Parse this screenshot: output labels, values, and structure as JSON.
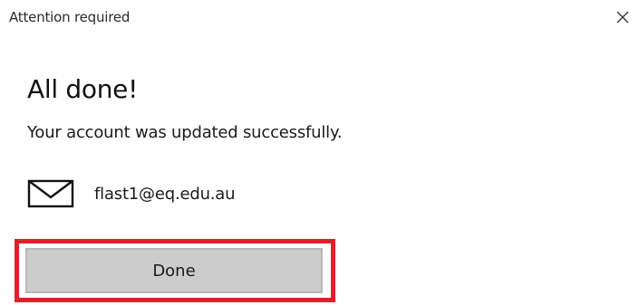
{
  "window": {
    "title": "Attention required",
    "close_icon": "close-icon"
  },
  "main": {
    "heading": "All done!",
    "message": "Your account was updated successfully.",
    "account": {
      "icon": "mail-icon",
      "email": "flast1@eq.edu.au"
    },
    "done_label": "Done"
  },
  "colors": {
    "highlight": "#e0202a",
    "button_bg": "#cccccc"
  }
}
